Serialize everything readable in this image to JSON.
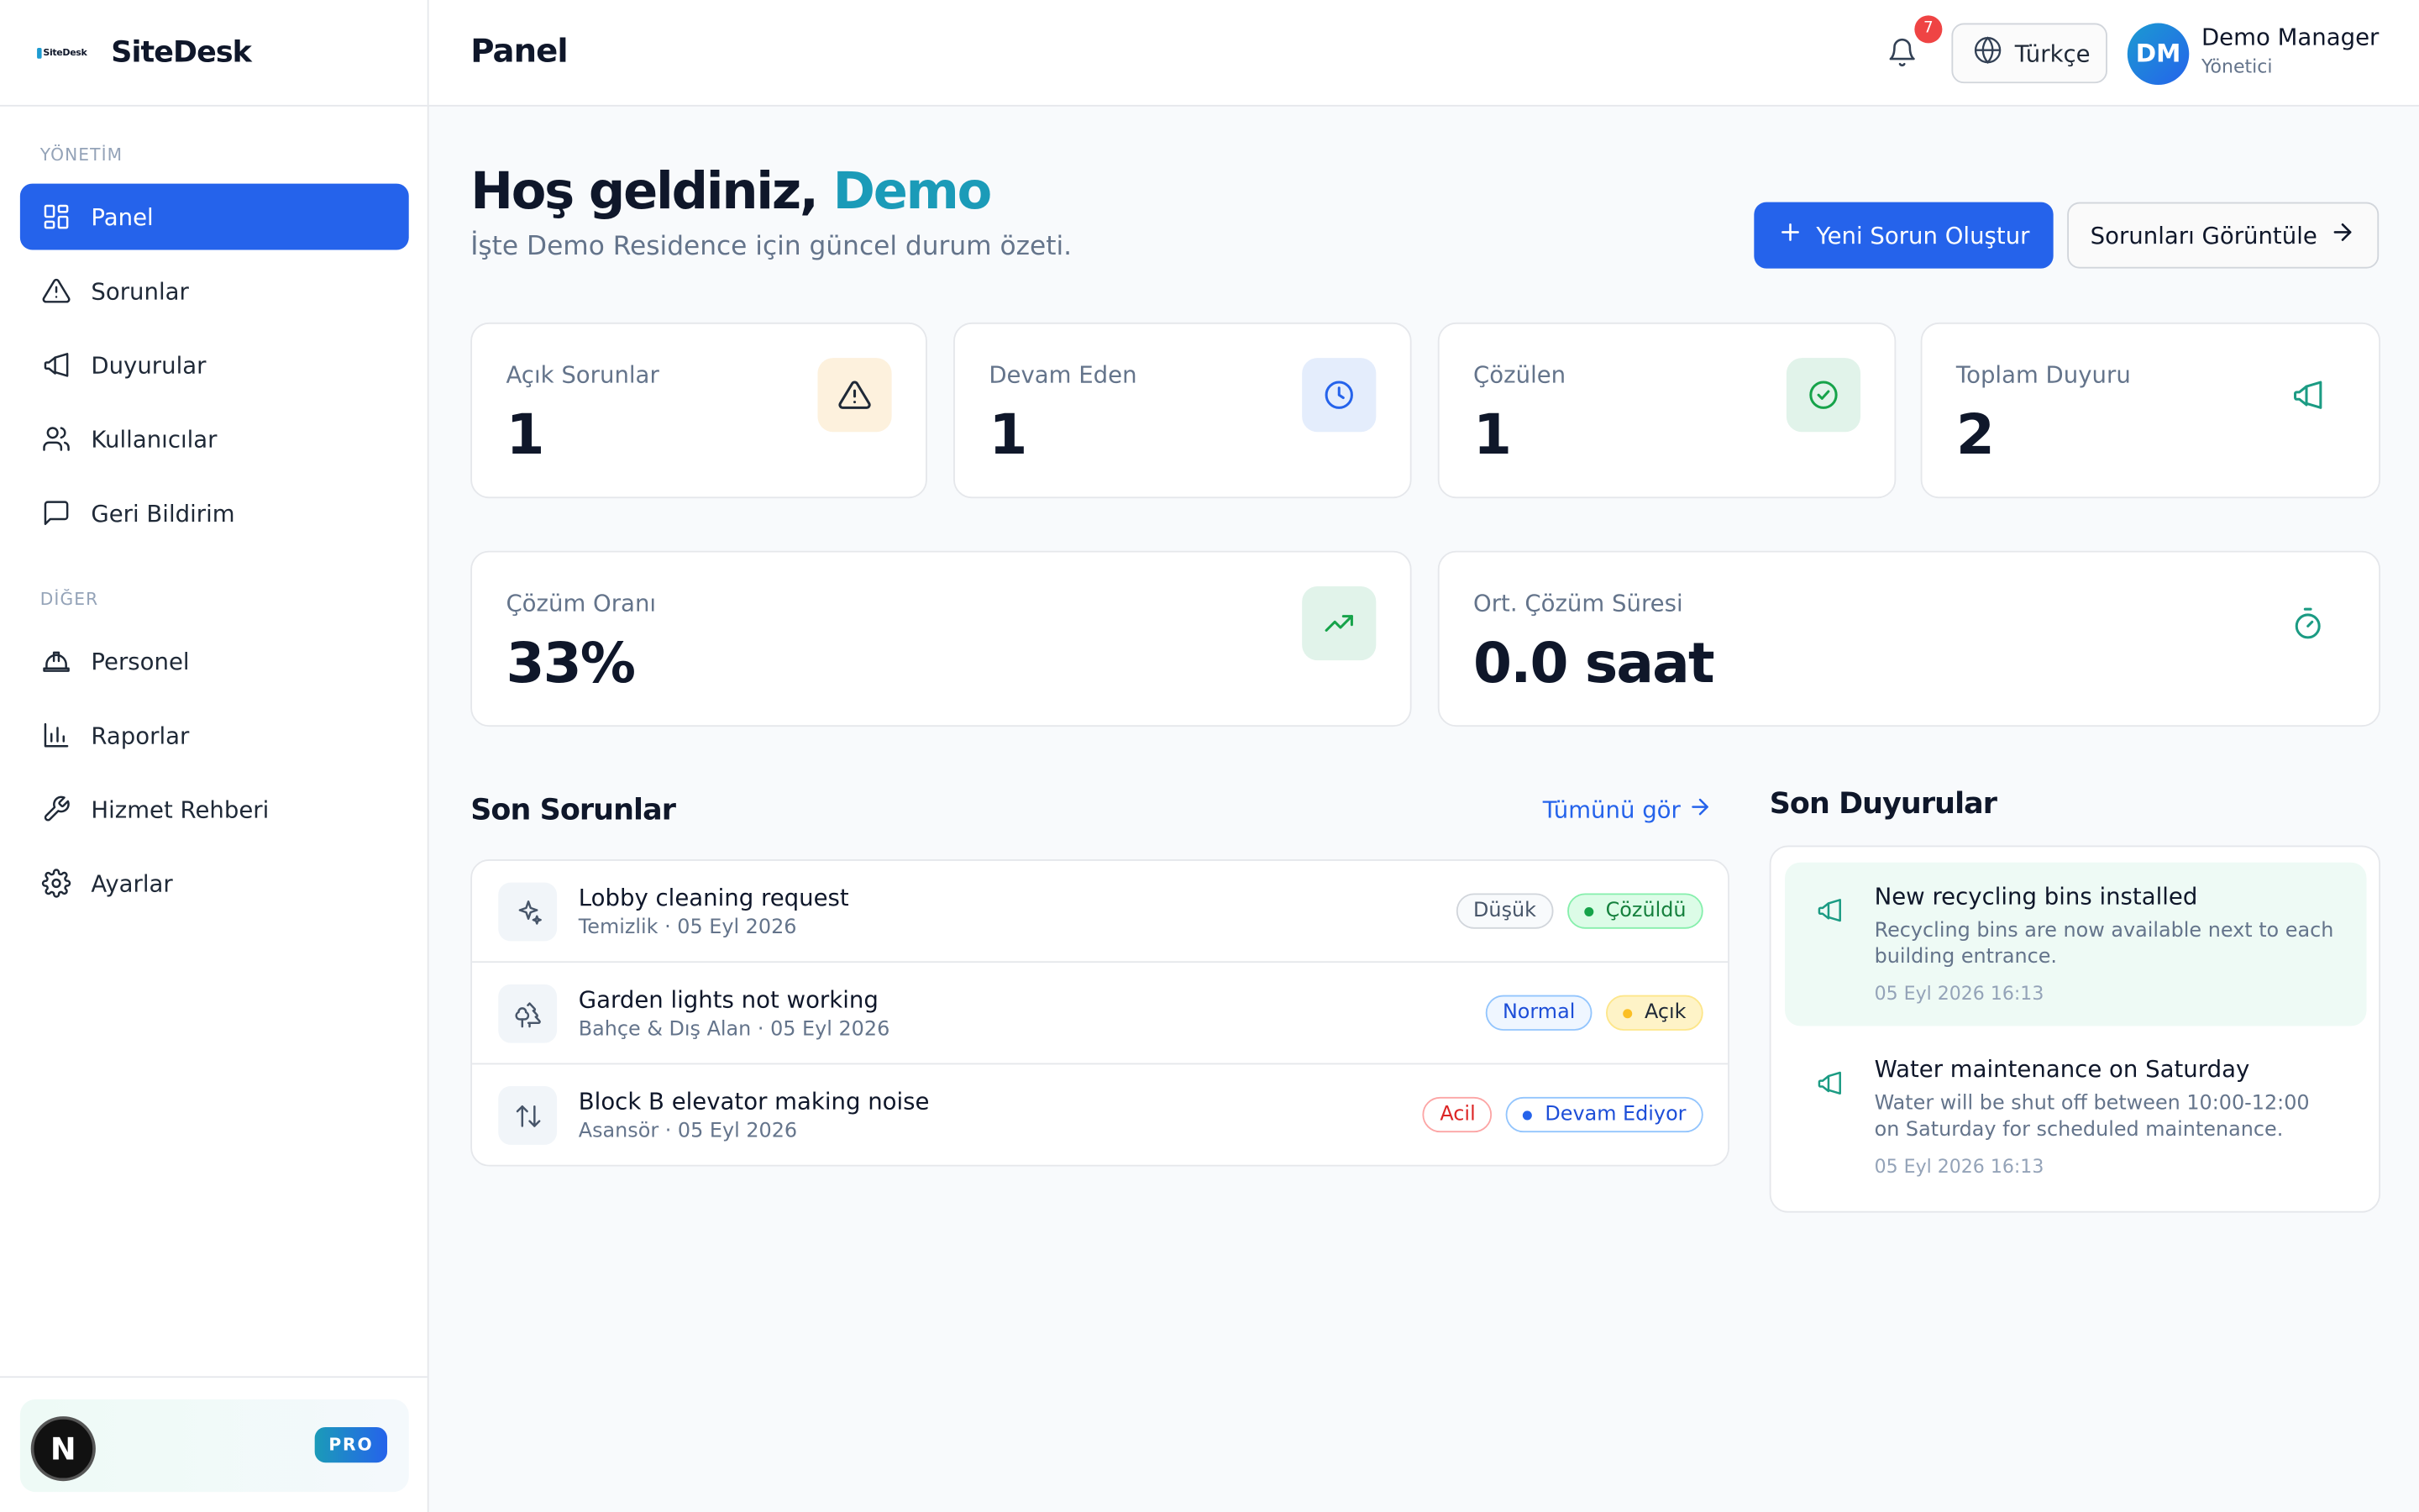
{
  "brand": {
    "logo_text": "SiteDesk",
    "name": "SiteDesk"
  },
  "sidebar": {
    "section_management": "YÖNETİM",
    "section_other": "DİĞER",
    "items": [
      {
        "label": "Panel",
        "icon": "dashboard-icon",
        "active": true
      },
      {
        "label": "Sorunlar",
        "icon": "warning-icon"
      },
      {
        "label": "Duyurular",
        "icon": "megaphone-icon"
      },
      {
        "label": "Kullanıcılar",
        "icon": "users-icon"
      },
      {
        "label": "Geri Bildirim",
        "icon": "message-icon"
      }
    ],
    "other_items": [
      {
        "label": "Personel",
        "icon": "hardhat-icon"
      },
      {
        "label": "Raporlar",
        "icon": "bar-chart-icon"
      },
      {
        "label": "Hizmet Rehberi",
        "icon": "wrench-icon"
      },
      {
        "label": "Ayarlar",
        "icon": "gear-icon"
      }
    ],
    "pro_badge": "PRO",
    "avatar_letter": "N"
  },
  "header": {
    "title": "Panel",
    "notification_count": "7",
    "language": "Türkçe",
    "user": {
      "initials": "DM",
      "name": "Demo Manager",
      "role": "Yönetici"
    }
  },
  "welcome": {
    "greeting": "Hoş geldiniz,",
    "name": "Demo",
    "subtitle": "İşte Demo Residence için güncel durum özeti.",
    "primary_button": "Yeni Sorun Oluştur",
    "secondary_button": "Sorunları Görüntüle"
  },
  "stats": [
    {
      "label": "Açık Sorunlar",
      "value": "1",
      "icon": "warning-icon"
    },
    {
      "label": "Devam Eden",
      "value": "1",
      "icon": "clock-icon"
    },
    {
      "label": "Çözülen",
      "value": "1",
      "icon": "check-circle-icon"
    },
    {
      "label": "Toplam Duyuru",
      "value": "2",
      "icon": "megaphone-icon"
    },
    {
      "label": "Çözüm Oranı",
      "value": "33%",
      "icon": "trending-up-icon"
    },
    {
      "label": "Ort. Çözüm Süresi",
      "value": "0.0 saat",
      "icon": "timer-icon"
    }
  ],
  "recent_issues": {
    "title": "Son Sorunlar",
    "see_all": "Tümünü gör",
    "items": [
      {
        "title": "Lobby cleaning request",
        "meta": "Temizlik · 05 Eyl 2026",
        "priority": "Düşük",
        "status": "Çözüldü",
        "icon": "sparkles-icon"
      },
      {
        "title": "Garden lights not working",
        "meta": "Bahçe & Dış Alan · 05 Eyl 2026",
        "priority": "Normal",
        "status": "Açık",
        "icon": "trees-icon"
      },
      {
        "title": "Block B elevator making noise",
        "meta": "Asansör · 05 Eyl 2026",
        "priority": "Acil",
        "status": "Devam Ediyor",
        "icon": "elevator-icon"
      }
    ]
  },
  "announcements": {
    "title": "Son Duyurular",
    "items": [
      {
        "title": "New recycling bins installed",
        "body": "Recycling bins are now available next to each building entrance.",
        "date": "05 Eyl 2026 16:13"
      },
      {
        "title": "Water maintenance on Saturday",
        "body": "Water will be shut off between 10:00-12:00 on Saturday for scheduled maintenance.",
        "date": "05 Eyl 2026 16:13"
      }
    ]
  },
  "colors": {
    "primary": "#2563eb",
    "accent": "#1b9bb8",
    "sidebar_active": "#2563eb"
  }
}
